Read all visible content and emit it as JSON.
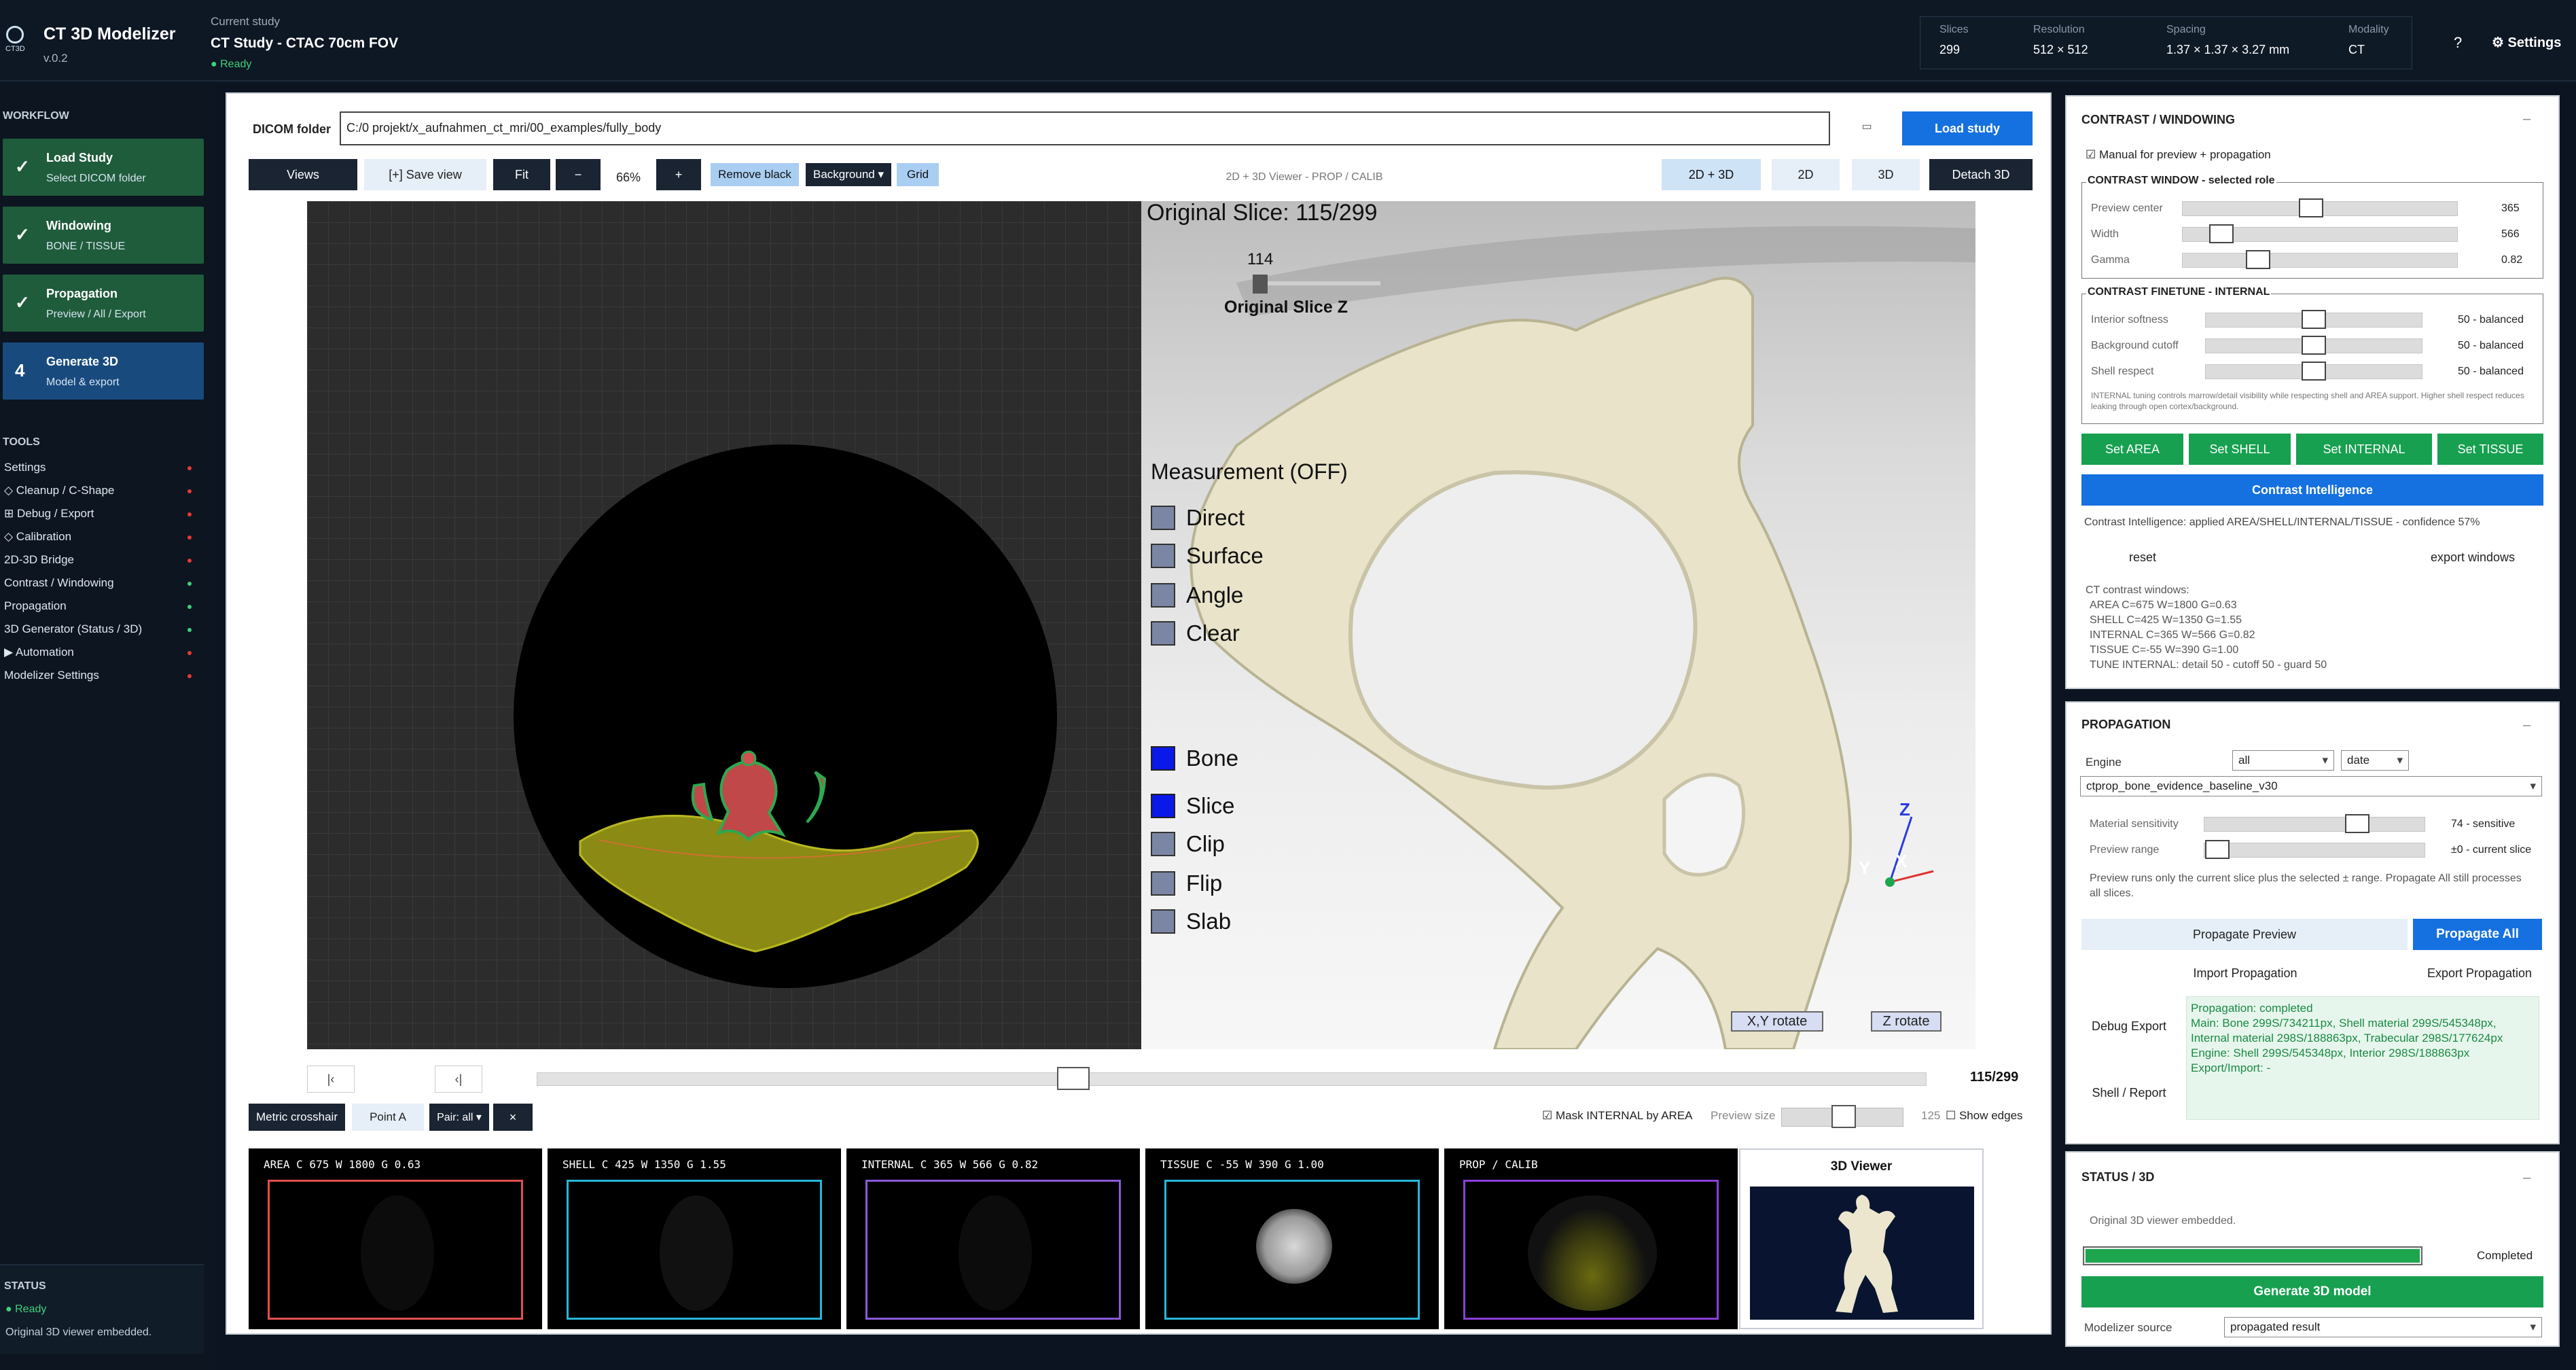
{
  "app": {
    "title": "CT 3D Modelizer",
    "version": "v.0.2",
    "logo_text": "CT3D"
  },
  "study": {
    "label": "Current study",
    "name": "CT Study - CTAC 70cm FOV",
    "status": "● Ready"
  },
  "stats": [
    {
      "key": "Slices",
      "value": "299"
    },
    {
      "key": "Resolution",
      "value": "512 × 512"
    },
    {
      "key": "Spacing",
      "value": "1.37 × 1.37 × 3.27 mm"
    },
    {
      "key": "Modality",
      "value": "CT"
    }
  ],
  "header": {
    "help": "?",
    "settings": "⚙ Settings"
  },
  "sidebar": {
    "workflow_title": "WORKFLOW",
    "steps": [
      {
        "mark": "✓",
        "title": "Load Study",
        "sub": "Select DICOM folder"
      },
      {
        "mark": "✓",
        "title": "Windowing",
        "sub": "BONE / TISSUE"
      },
      {
        "mark": "✓",
        "title": "Propagation",
        "sub": "Preview / All / Export"
      },
      {
        "mark": "4",
        "title": "Generate 3D",
        "sub": "Model & export"
      }
    ],
    "tools_title": "TOOLS",
    "tools": [
      {
        "label": "Settings",
        "dot": "#e53935"
      },
      {
        "label": "◇ Cleanup / C-Shape",
        "dot": "#e53935"
      },
      {
        "label": "⊞ Debug / Export",
        "dot": "#e53935"
      },
      {
        "label": "◇ Calibration",
        "dot": "#e53935"
      },
      {
        "label": "2D-3D Bridge",
        "dot": "#e53935"
      },
      {
        "label": "Contrast / Windowing",
        "dot": "#3fd07a"
      },
      {
        "label": "Propagation",
        "dot": "#3fd07a"
      },
      {
        "label": "3D Generator (Status / 3D)",
        "dot": "#3fd07a"
      },
      {
        "label": "▶ Automation",
        "dot": "#e53935"
      },
      {
        "label": "Modelizer Settings",
        "dot": "#e53935"
      }
    ],
    "status_title": "STATUS",
    "status_ready": "● Ready",
    "status_msg": "Original 3D viewer embedded."
  },
  "main": {
    "dicom_label": "DICOM folder",
    "dicom_path": "C:/0 projekt/x_aufnahmen_ct_mri/00_examples/fully_body",
    "folder_icon": "▭",
    "load_study": "Load study",
    "toolbar": {
      "views": "Views",
      "save_view": "[+] Save view",
      "fit": "Fit",
      "minus": "−",
      "zoom": "66%",
      "plus": "+",
      "remove_black": "Remove black",
      "background": "Background ▾",
      "grid": "Grid",
      "caption": "2D + 3D Viewer - PROP / CALIB",
      "mode_2d3d": "2D + 3D",
      "mode_2d": "2D",
      "mode_3d": "3D",
      "detach": "Detach 3D"
    },
    "viewer3d": {
      "slice_title": "Original Slice: 115/299",
      "slice_num": "114",
      "slice_label": "Original Slice Z",
      "meas_title": "Measurement (OFF)",
      "meas_items": [
        "Direct",
        "Surface",
        "Angle",
        "Clear"
      ],
      "layer_items": [
        "Bone",
        "Slice",
        "Clip",
        "Flip",
        "Slab"
      ],
      "axis_z": "Z",
      "axis_y": "Y",
      "axis_x": "X",
      "rot_xy": "X,Y rotate",
      "rot_z": "Z rotate"
    },
    "slider": {
      "first": "|‹",
      "prev": "‹|",
      "counter": "115/299",
      "value": 115,
      "max": 299
    },
    "bottom": {
      "metric_crosshair": "Metric crosshair",
      "point_a": "Point A",
      "pair": "Pair: all ▾",
      "close": "×",
      "mask_internal": "☑ Mask INTERNAL by AREA",
      "preview_size_label": "Preview size",
      "preview_size_value": "125",
      "show_edges": "☐ Show edges"
    },
    "roles": [
      {
        "label": "AREA    C   675  W  1800  G 0.63",
        "color": "#e05050"
      },
      {
        "label": "SHELL    C   425  W  1350  G 1.55",
        "color": "#29b6d9"
      },
      {
        "label": "INTERNAL C   365  W   566  G 0.82",
        "color": "#8a5ad8"
      },
      {
        "label": "TISSUE   C   -55  W   390  G 1.00",
        "color": "#29b6d9"
      },
      {
        "label": "PROP / CALIB",
        "color": "#8a3fd8"
      }
    ],
    "viewer_card_title": "3D Viewer"
  },
  "contrast": {
    "title": "CONTRAST / WINDOWING",
    "collapse": "–",
    "manual": "☑ Manual for preview + propagation",
    "window_legend": "CONTRAST WINDOW - selected role",
    "window_rows": [
      {
        "name": "Preview center",
        "value": "365",
        "frac": 0.47
      },
      {
        "name": "Width",
        "value": "566",
        "frac": 0.14
      },
      {
        "name": "Gamma",
        "value": "0.82",
        "frac": 0.27
      }
    ],
    "finetune_legend": "CONTRAST FINETUNE - INTERNAL",
    "finetune_rows": [
      {
        "name": "Interior softness",
        "value": "50 - balanced",
        "frac": 0.5
      },
      {
        "name": "Background cutoff",
        "value": "50 - balanced",
        "frac": 0.5
      },
      {
        "name": "Shell respect",
        "value": "50 - balanced",
        "frac": 0.5
      }
    ],
    "finetune_note": "INTERNAL tuning controls marrow/detail visibility while respecting shell and AREA support. Higher shell respect reduces leaking through open cortex/background.",
    "set_buttons": [
      "Set AREA",
      "Set SHELL",
      "Set INTERNAL",
      "Set TISSUE"
    ],
    "intelligence_button": "Contrast Intelligence",
    "intelligence_msg": "Contrast Intelligence: applied AREA/SHELL/INTERNAL/TISSUE - confidence 57%",
    "reset": "reset",
    "export_windows": "export windows",
    "windows_title": "CT contrast windows:",
    "windows_lines": [
      "AREA C=675 W=1800 G=0.63",
      "SHELL C=425 W=1350 G=1.55",
      "INTERNAL C=365 W=566 G=0.82",
      "TISSUE C=-55 W=390 G=1.00",
      "TUNE INTERNAL: detail 50 - cutoff 50 - guard 50"
    ]
  },
  "propagation": {
    "title": "PROPAGATION",
    "collapse": "–",
    "engine_label": "Engine",
    "engine_value": "all",
    "sort_value": "date",
    "preset": "ctprop_bone_evidence_baseline_v30",
    "material_label": "Material sensitivity",
    "material_value": "74 - sensitive",
    "material_frac": 0.74,
    "range_label": "Preview range",
    "range_value": "±0 - current slice",
    "range_frac": 0.0,
    "note": "Preview runs only the current slice plus the selected ± range. Propagate All still processes all slices.",
    "preview_btn": "Propagate Preview",
    "all_btn": "Propagate All",
    "import_btn": "Import Propagation",
    "export_btn": "Export Propagation",
    "debug_export": "Debug Export",
    "shell_report": "Shell / Report",
    "log": [
      "Propagation: completed",
      "Main: Bone 299S/734211px, Shell material 299S/545348px,",
      "Internal material 298S/188863px, Trabecular 298S/177624px",
      "Engine: Shell 299S/545348px, Interior 298S/188863px",
      "Export/Import: -"
    ]
  },
  "status3d": {
    "title": "STATUS / 3D",
    "collapse": "–",
    "msg": "Original 3D viewer embedded.",
    "progress": 1.0,
    "progress_label": "Completed",
    "generate_btn": "Generate 3D model",
    "source_label": "Modelizer source",
    "source_value": "propagated result"
  }
}
